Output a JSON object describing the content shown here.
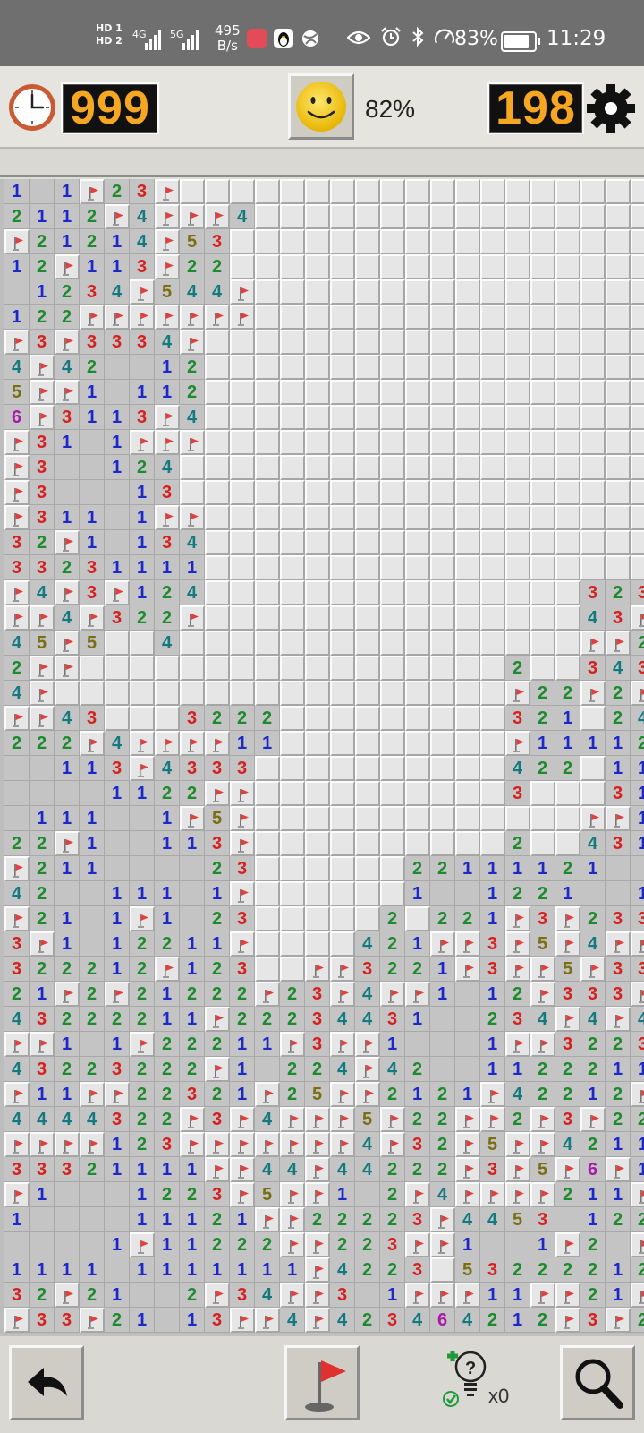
{
  "status_bar": {
    "hd1": "HD 1",
    "hd2": "HD 2",
    "net1": "4G",
    "net2": "5G",
    "speed_value": "495",
    "speed_unit": "B/s",
    "battery": "83%",
    "time": "11:29"
  },
  "header": {
    "timer": "999",
    "progress": "82%",
    "mines_left": "198"
  },
  "toolbar": {
    "hint_count": "x0"
  },
  "colors": {
    "1": "#1c28c8",
    "2": "#1e8a2e",
    "3": "#d62020",
    "4": "#137a80",
    "5": "#7a6e12",
    "6": "#a81aa8",
    "flag": "#e04040",
    "led": "#f5a623"
  },
  "board": {
    "cols": 26,
    "rows": 46,
    "legend": "U = unrevealed, F = flag, . = empty, digit = adjacent mine count",
    "grid": [
      "1.1F23FUUUUUUUUUUUUUUUUUUU",
      "2112F4FFF4UUUUUUUUUUUUUUUU",
      "F21214F53UUUUUUUUUUUUUUUUU",
      "12F113F22UUUUUUUUUUUUUUUUU",
      ".1234F544FUUUUUUUUUUUUUUUU",
      "122FFFFFFFUUUUUUUUUUUUUUUU",
      "F3F3334FUUUUUUUUUUUUUUUUUU",
      "4F42..12UUUUUUUUUUUUUUUUUU",
      "5FF1.112UUUUUUUUUUUUUUUUUU",
      "6F3113F4UUUUUUUUUUUUUUUUUU",
      "F31.1FFFUUUUUUUUUUUUUUUUUU",
      "F3..124UUUUUUUUUUUUUUUUUUU",
      "F3...13UUUUUUUUUUUUUUUUUUU",
      "F311.1FFUUUUUUUUUUUUUUUUUU",
      "32F1.134UUUUUUUUUUUUUUUUUU",
      "33231111UUUUUUUUUUUUUUUUUU",
      "F4F3F124UUUUUUUUUUUUUUU323",
      "FF4F322FUUUUUUUUUUUUUUU43F",
      "45F5UU4UUUUUUUUUUUUUUUUFF2",
      "2FFUUUUUUUUUUUUUUUUU2UU343",
      "4FUUUUUUUUUUUUUUUUUUF22F2F",
      "FF43UUU3222UUUUUUUUU321U24",
      "222F4FFFF11UUUUUUUUUF11112",
      "..113F4333UUUUUUUUUU422U11",
      "....1122FFUUUUUUUUUU3UUU31",
      ".111..1F5FUUUUUUUUUUUUUFF1",
      "22F1..113FUUUUUUUUUU2UU431",
      "F211....23UUUUUU22111121..",
      "42..111.1FUUUUUU1..1221..1",
      "F21.1F1.23UUUUU2U221F3F233",
      "3F1.12211FUUUU421FF3F5F4FF",
      "322212F123UUFF3221F3FF5F334",
      "21F2F21222F23F4FF1.12F333F",
      "43222211F22234431..234F4F4",
      "FF1.1F22211F3FF1...1FF3223",
      "43223222F1.224F42..11222112",
      "F11FF22321F25FF2121F42212F",
      "4444322F3F4FFF5F22FF2F3F22",
      "FFFF123FFFFFFF4F32F5FF4211",
      "33321111FF44F44222F3F5F6F112",
      "F1...1223F5FF1.2F4FFFF211F",
      "1....11121FF22223F4453.122",
      "....1F11222FF223FF1..1F2.F",
      "1111.1111111F4223U532222121",
      "32F21..2F34FF3.1FFF11FF21F",
      "F33F21.13FF4F423464212F3F2F"
    ]
  }
}
